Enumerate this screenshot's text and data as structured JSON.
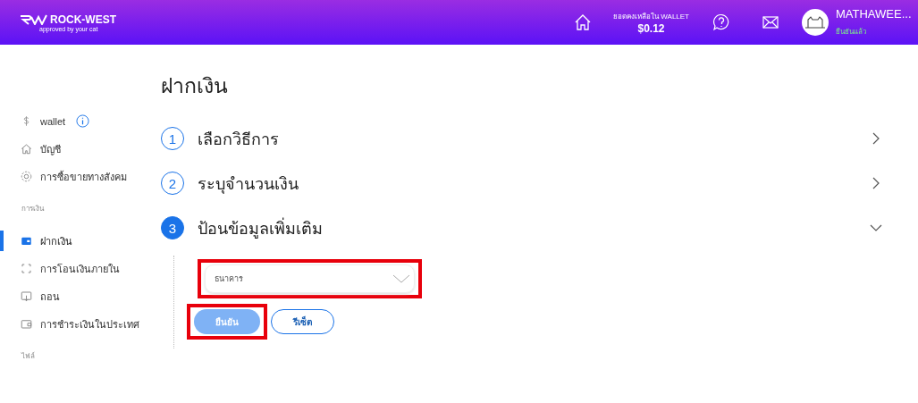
{
  "header": {
    "logo": {
      "name": "ROCK-WEST",
      "tagline": "approved by your cat"
    },
    "balance": {
      "label": "ยอดคงเหลือใน WALLET",
      "amount": "$0.12"
    },
    "user": {
      "name": "MATHAWEE...",
      "status": "ยืนยันแล้ว"
    }
  },
  "sidebar": {
    "groups": [
      {
        "items": [
          {
            "label": "wallet",
            "kind": "dollar",
            "info": true,
            "selected": false
          },
          {
            "label": "บัญชี",
            "kind": "home",
            "info": false,
            "selected": false
          },
          {
            "label": "การซื้อขายทางสังคม",
            "kind": "gear",
            "info": false,
            "selected": false
          }
        ]
      },
      {
        "title": "การเงิน",
        "items": [
          {
            "label": "ฝากเงิน",
            "kind": "wallet",
            "info": false,
            "selected": true
          },
          {
            "label": "การโอนเงินภายใน",
            "kind": "transfer",
            "info": false,
            "selected": false
          },
          {
            "label": "ถอน",
            "kind": "withdraw",
            "info": false,
            "selected": false
          },
          {
            "label": "การชำระเงินในประเทศ",
            "kind": "card",
            "info": false,
            "selected": false
          }
        ]
      },
      {
        "title": "ไฟล์"
      }
    ]
  },
  "page": {
    "title": "ฝากเงิน",
    "steps": [
      {
        "number": "1",
        "label": "เลือกวิธีการ",
        "expanded": false
      },
      {
        "number": "2",
        "label": "ระบุจำนวนเงิน",
        "expanded": false
      },
      {
        "number": "3",
        "label": "ป้อนข้อมูลเพิ่มเติม",
        "expanded": true
      }
    ],
    "form": {
      "bank_select": {
        "placeholder": "ธนาคาร",
        "highlighted": true
      },
      "buttons": [
        {
          "label": "ยืนยัน",
          "kind": "primary",
          "disabled": true,
          "highlighted": true
        },
        {
          "label": "รีเซ็ต",
          "kind": "secondary",
          "disabled": false,
          "highlighted": false
        }
      ]
    }
  }
}
